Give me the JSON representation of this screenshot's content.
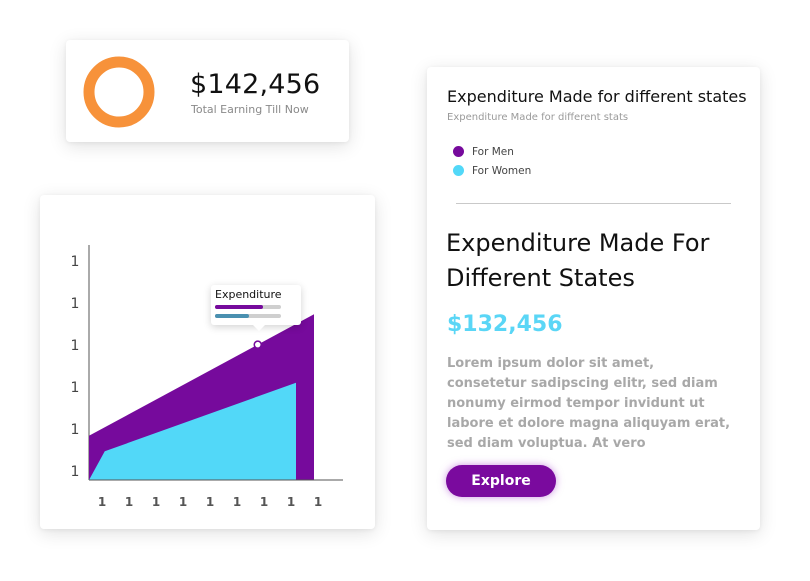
{
  "earnings": {
    "amount": "$142,456",
    "label": "Total Earning Till Now",
    "ring_color": "#f7923a"
  },
  "chart_data": {
    "type": "area",
    "x_tick_labels": [
      "1",
      "1",
      "1",
      "1",
      "1",
      "1",
      "1",
      "1",
      "1"
    ],
    "y_tick_labels": [
      "1",
      "1",
      "1",
      "1",
      "1",
      "1"
    ],
    "series": [
      {
        "color": "#760a9c",
        "x": [
          0,
          1
        ],
        "values": [
          0.2,
          0.75
        ]
      },
      {
        "color": "#52d8f8",
        "x": [
          0,
          0.07,
          0.92
        ],
        "values": [
          0.0,
          0.13,
          0.44
        ]
      }
    ],
    "tooltip": {
      "title": "Expenditure",
      "bars": [
        {
          "color": "#760a9c",
          "fraction": 0.72
        },
        {
          "color": "#4a90b0",
          "fraction": 0.52
        }
      ]
    }
  },
  "state_card": {
    "title": "Expenditure Made for different states",
    "subtitle": "Expenditure Made for different stats",
    "legend": [
      {
        "label": "For Men",
        "color": "#760a9c"
      },
      {
        "label": "For Women",
        "color": "#52d8f8"
      }
    ],
    "heading": "Expenditure Made For Different States",
    "amount": "$132,456",
    "body": "Lorem ipsum dolor sit amet, consetetur sadipscing elitr, sed diam nonumy eirmod tempor invidunt ut labore et dolore magna aliquyam erat, sed diam voluptua. At vero",
    "button_label": "Explore"
  }
}
